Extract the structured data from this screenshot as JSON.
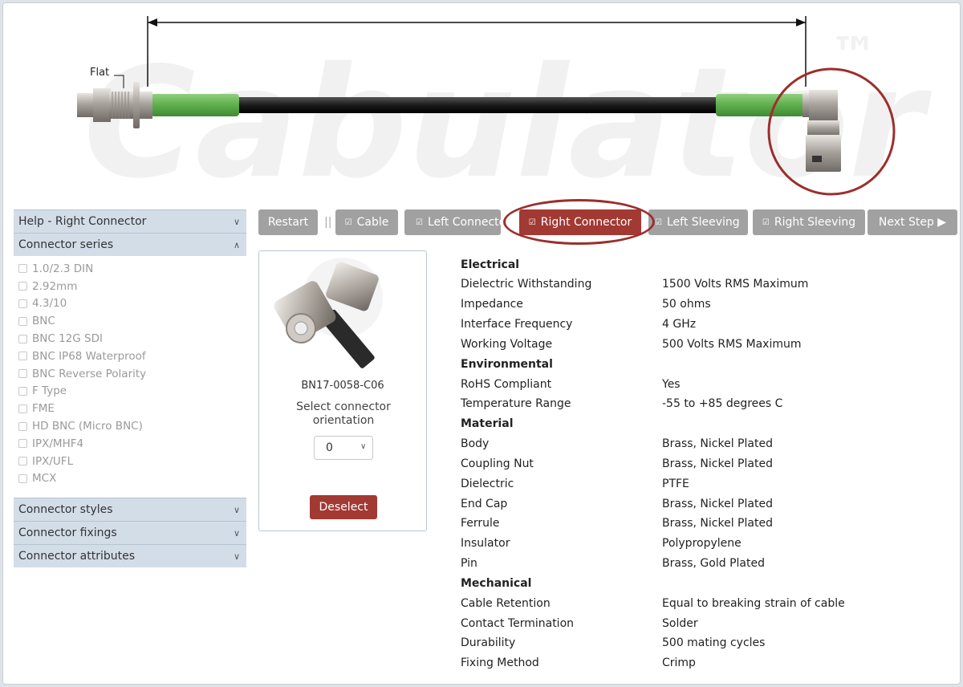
{
  "banner": {
    "watermark": "Cabulator",
    "watermark_tm": "™",
    "flat_label": "Flat"
  },
  "sidebar": {
    "help_title": "Help - Right Connector",
    "series_title": "Connector series",
    "series": [
      "1.0/2.3 DIN",
      "2.92mm",
      "4.3/10",
      "BNC",
      "BNC 12G SDI",
      "BNC IP68 Waterproof",
      "BNC Reverse Polarity",
      "F Type",
      "FME",
      "HD BNC (Micro BNC)",
      "IPX/MHF4",
      "IPX/UFL",
      "MCX"
    ],
    "styles_title": "Connector styles",
    "fixings_title": "Connector fixings",
    "attributes_title": "Connector attributes"
  },
  "steps": {
    "restart": "Restart",
    "separator": "||",
    "cable": "Cable",
    "left_connector": "Left Connecto",
    "right_connector": "Right Connector",
    "left_sleeving": "Left Sleeving",
    "right_sleeving": "Right Sleeving",
    "next_step": "Next Step ▶",
    "tick": "☑"
  },
  "card": {
    "part_number": "BN17-0058-C06",
    "orientation_label": "Select connector orientation",
    "orientation_value": "0",
    "deselect": "Deselect"
  },
  "specs": [
    {
      "group": "Electrical",
      "rows": [
        [
          "Dielectric Withstanding",
          "1500 Volts RMS Maximum"
        ],
        [
          "Impedance",
          "50 ohms"
        ],
        [
          "Interface Frequency",
          "4 GHz"
        ],
        [
          "Working Voltage",
          "500 Volts RMS Maximum"
        ]
      ]
    },
    {
      "group": "Environmental",
      "rows": [
        [
          "RoHS Compliant",
          "Yes"
        ],
        [
          "Temperature Range",
          "-55 to +85 degrees C"
        ]
      ]
    },
    {
      "group": "Material",
      "rows": [
        [
          "Body",
          "Brass, Nickel Plated"
        ],
        [
          "Coupling Nut",
          "Brass, Nickel Plated"
        ],
        [
          "Dielectric",
          "PTFE"
        ],
        [
          "End Cap",
          "Brass, Nickel Plated"
        ],
        [
          "Ferrule",
          "Brass, Nickel Plated"
        ],
        [
          "Insulator",
          "Polypropylene"
        ],
        [
          "Pin",
          "Brass, Gold Plated"
        ]
      ]
    },
    {
      "group": "Mechanical",
      "rows": [
        [
          "Cable Retention",
          "Equal to breaking strain of cable"
        ],
        [
          "Contact Termination",
          "Solder"
        ],
        [
          "Durability",
          "500 mating cycles"
        ],
        [
          "Fixing Method",
          "Crimp"
        ]
      ]
    }
  ],
  "colors": {
    "accent": "#a23933",
    "step_grey": "#a1a1a1",
    "sidebar_header": "#d3dde8",
    "cable_green": "#6dbb5a"
  }
}
